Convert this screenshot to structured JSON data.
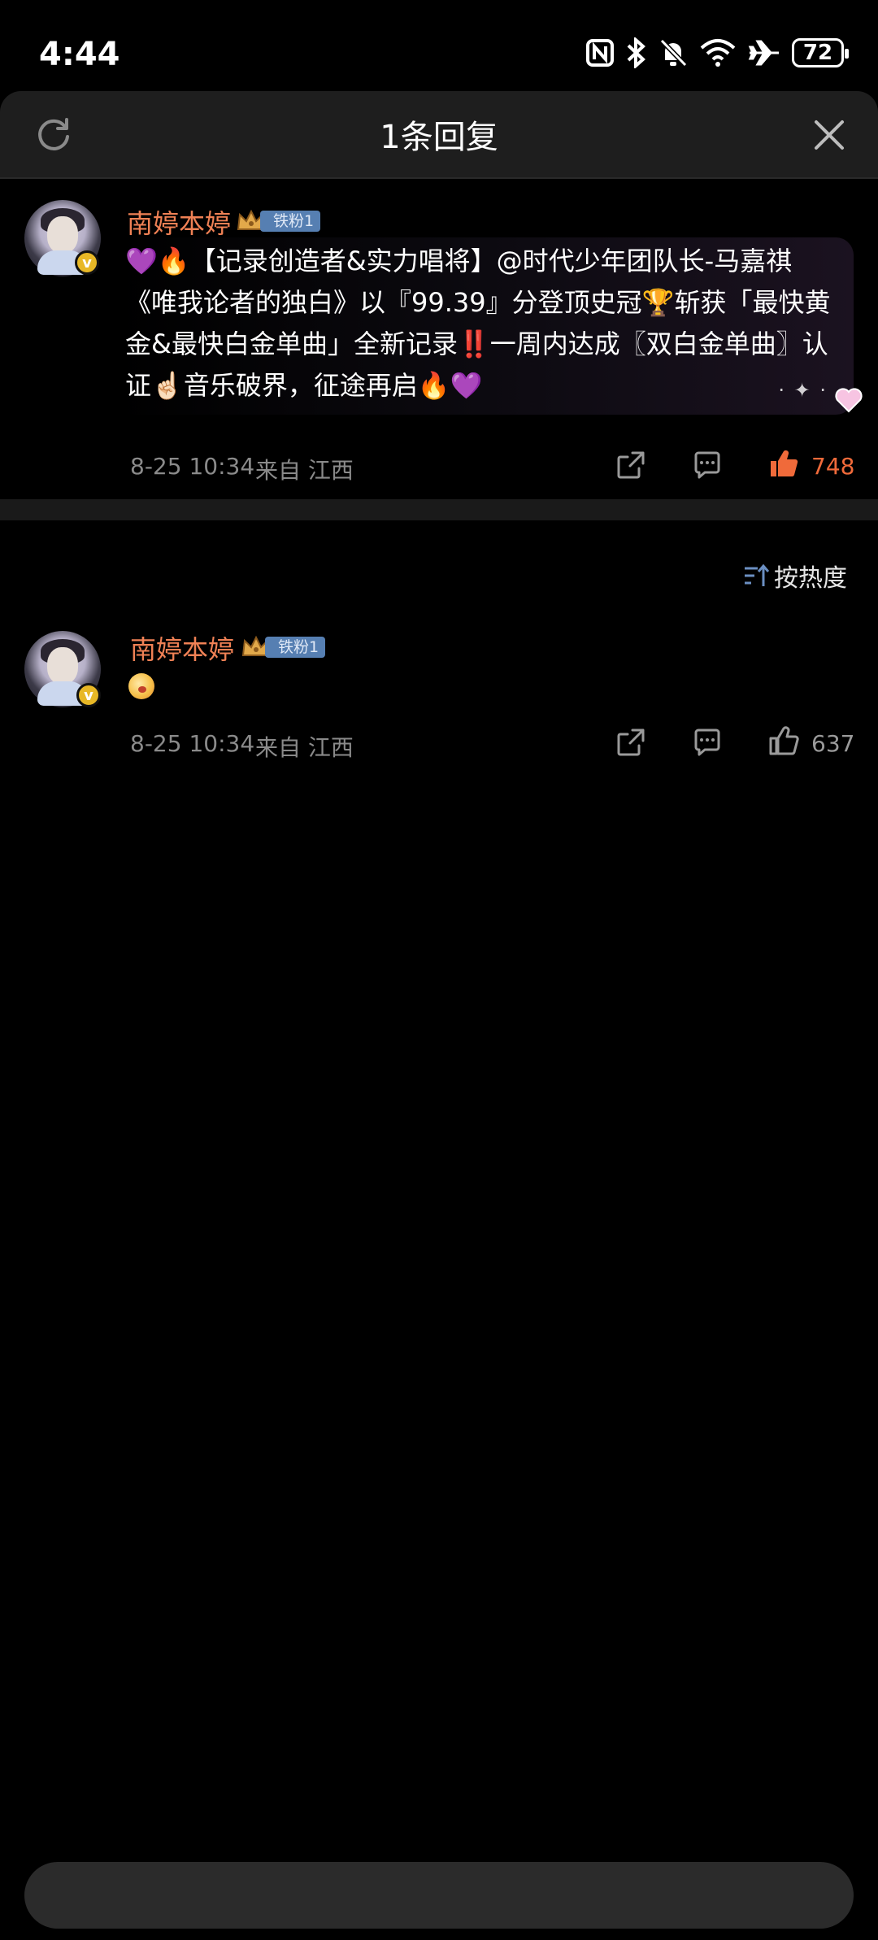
{
  "status_bar": {
    "time": "4:44",
    "battery": "72"
  },
  "header": {
    "title": "1条回复"
  },
  "main_comment": {
    "username": "南婷本婷",
    "fan_badge": "铁粉1",
    "text": "💜🔥【记录创造者&实力唱将】@时代少年团队长-马嘉祺《唯我论者的独白》以『99.39』分登顶史冠🏆斩获「最快黄金&最快白金单曲」全新记录‼️一周内达成〖双白金单曲〗认证☝🏻音乐破界，征途再启🔥💜",
    "timestamp": "8-25 10:34",
    "location": "来自 江西",
    "likes": "748",
    "liked": true
  },
  "sort": {
    "label": "按热度"
  },
  "reply": {
    "username": "南婷本婷",
    "fan_badge": "铁粉1",
    "timestamp": "8-25 10:34",
    "location": "来自 江西",
    "likes": "637",
    "liked": false
  },
  "input": {
    "placeholder": ""
  },
  "colors": {
    "username": "#f08155",
    "liked": "#f06a3a",
    "muted": "#8a8a8a",
    "badge": "#567fb2",
    "background": "#000000",
    "header": "#1e1e1e",
    "divider": "#1a1a1a"
  },
  "icons": [
    "nfc-icon",
    "bluetooth-icon",
    "mute-bell-icon",
    "wifi-icon",
    "airplane-icon",
    "battery-icon",
    "refresh-icon",
    "close-icon",
    "crown-icon",
    "share-icon",
    "comment-icon",
    "like-icon",
    "sort-icon"
  ]
}
